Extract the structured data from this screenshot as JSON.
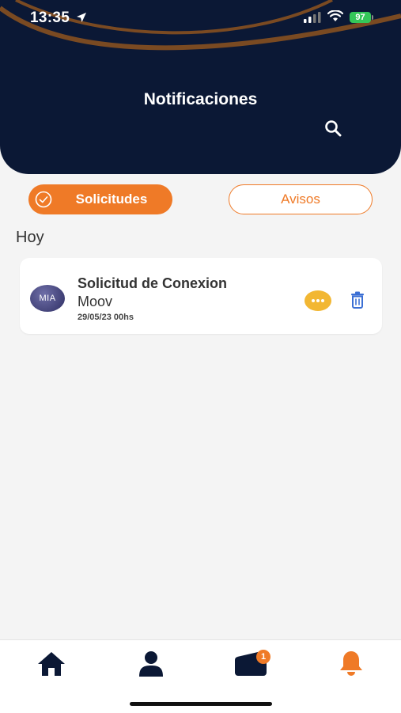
{
  "status_bar": {
    "time": "13:35",
    "battery": "97"
  },
  "header": {
    "title": "Notificaciones"
  },
  "tabs": [
    {
      "label": "Solicitudes",
      "active": true
    },
    {
      "label": "Avisos",
      "active": false
    }
  ],
  "section_label": "Hoy",
  "notifications": [
    {
      "avatar_text": "MIA",
      "title": "Solicitud de Conexion",
      "subtitle": "Moov",
      "date": "29/05/23 00hs"
    }
  ],
  "bottom_nav": {
    "items": [
      "home-icon",
      "profile-icon",
      "wallet-icon",
      "bell-icon"
    ],
    "wallet_badge": "1",
    "active": "bell-icon"
  },
  "colors": {
    "header_bg": "#0b1835",
    "accent": "#ef7a27",
    "more_button": "#f2b733",
    "trash": "#3b6fd4",
    "nav_icon": "#0b1835"
  }
}
